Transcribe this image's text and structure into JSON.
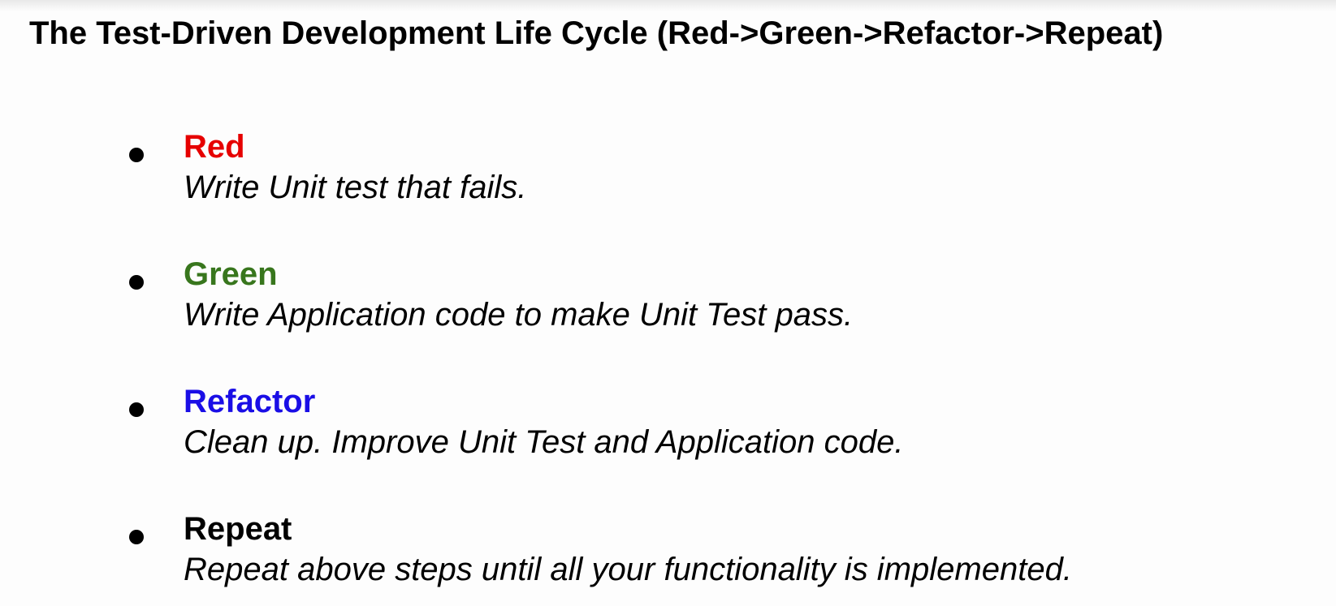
{
  "slide": {
    "title": "The Test-Driven Development Life Cycle (Red->Green->Refactor->Repeat)"
  },
  "steps": [
    {
      "heading": "Red",
      "description": "Write Unit test that fails.",
      "color": "#e60000"
    },
    {
      "heading": "Green",
      "description": "Write Application code to make Unit Test pass.",
      "color": "#38761d"
    },
    {
      "heading": "Refactor",
      "description": "Clean up. Improve Unit Test and Application code.",
      "color": "#1a0ee6"
    },
    {
      "heading": "Repeat",
      "description": "Repeat above steps until all your functionality is implemented.",
      "color": "#000000"
    }
  ]
}
